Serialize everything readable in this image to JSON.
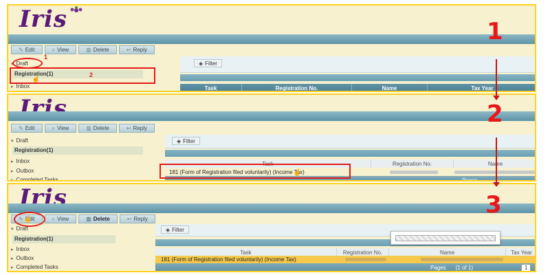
{
  "app": {
    "logo": "Iris"
  },
  "annotations": {
    "step1": "1",
    "step2": "2",
    "step3": "3",
    "callout_draft": "1",
    "callout_registration": "2"
  },
  "toolbar": {
    "edit": "Edit",
    "view": "View",
    "delete": "Delete",
    "reply": "Reply"
  },
  "sidebar": {
    "draft": "Draft",
    "registration": "Registration(1)",
    "inbox": "Inbox",
    "outbox": "Outbox",
    "completed": "Completed Tasks"
  },
  "content": {
    "filter": "Filter",
    "columns": {
      "task": "Task",
      "registration_no": "Registration No.",
      "name": "Name",
      "tax_year": "Tax Year"
    },
    "row_task": "181 (Form of Registration filed voluntarily) (Income Tax)",
    "pages_label": "Pages",
    "pages_value": "(1 of 1)",
    "page_number": "1"
  },
  "icons": {
    "edit": "pencil-icon",
    "view": "magnifier-icon",
    "delete": "trash-icon",
    "reply": "reply-icon",
    "filter": "filter-icon",
    "cursor": "hand-pointer-icon"
  },
  "colors": {
    "accent_red": "#e21a1a",
    "panel_border": "#ffd21f",
    "header_teal": "#5d93a6",
    "logo_purple": "#5b1a7a",
    "selected_row": "#f6c94d"
  }
}
